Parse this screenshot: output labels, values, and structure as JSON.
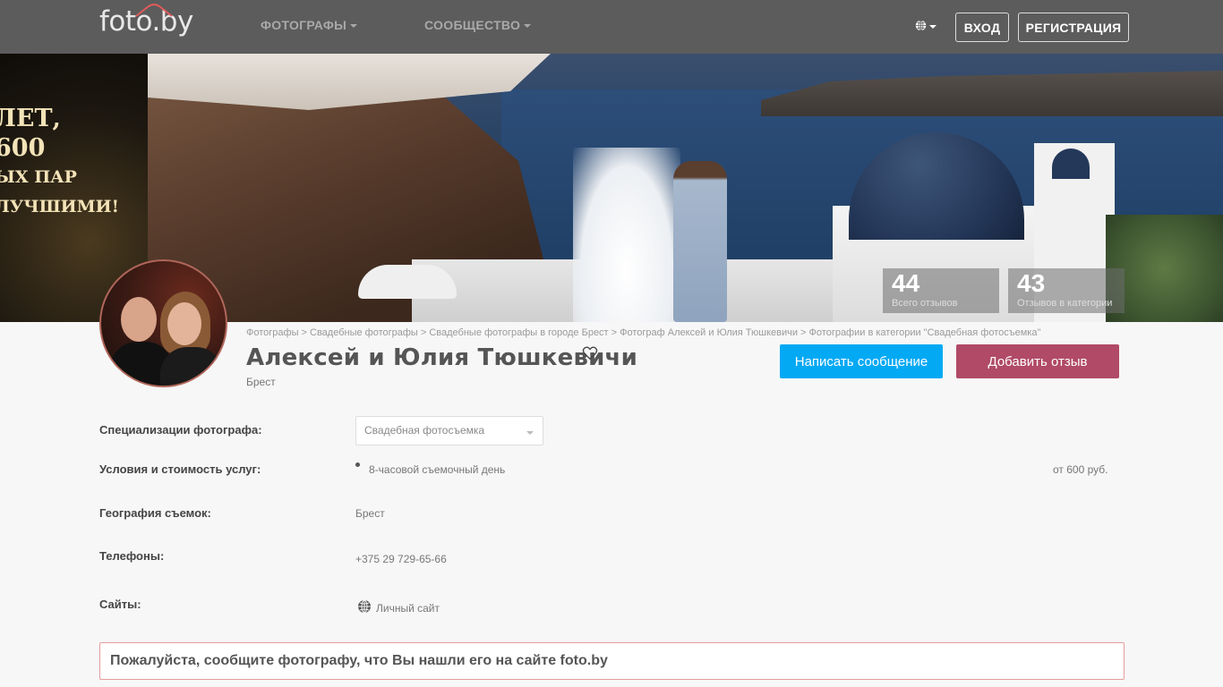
{
  "header": {
    "logo": "foto.by",
    "nav": [
      "ФОТОГРАФЫ",
      "СООБЩЕСТВО"
    ],
    "login_label": "ВХОД",
    "register_label": "РЕГИСТРАЦИЯ"
  },
  "banner": {
    "ad_text": [
      "ЛЕТ,",
      "600",
      "ЫХ ПАР",
      "ЛУЧШИМИ!"
    ],
    "stats": [
      {
        "value": "44",
        "label": "Всего отзывов"
      },
      {
        "value": "43",
        "label": "Отзывов в категории"
      }
    ]
  },
  "profile": {
    "breadcrumb": "Фотографы > Свадебные фотографы > Свадебные фотографы в городе Брест > Фотограф Алексей и Юлия Тюшкевичи > Фотографии в категории \"Свадебная фотосъемка\"",
    "name": "Алексей и Юлия Тюшкевичи",
    "city": "Брест",
    "message_button": "Написать сообщение",
    "review_button": "Добавить отзыв"
  },
  "info": {
    "specialization_label": "Специализации фотографа:",
    "specialization_value": "Свадебная фотосъемка",
    "conditions_label": "Условия и стоимость услуг:",
    "service": "8-часовой съемочный день",
    "price": "от 600 руб.",
    "geography_label": "География съемок:",
    "geography_value": "Брест",
    "phones_label": "Телефоны:",
    "phone": "+375 29 729-65-66",
    "sites_label": "Сайты:",
    "site": "Личный сайт"
  },
  "notice": "Пожалуйста, сообщите фотографу, что Вы нашли его на сайте foto.by",
  "colors": {
    "topbar": "#5c5c5c",
    "message_button": "#04a9f4",
    "review_button": "#b04a67",
    "notice_border": "#e59c9c"
  }
}
